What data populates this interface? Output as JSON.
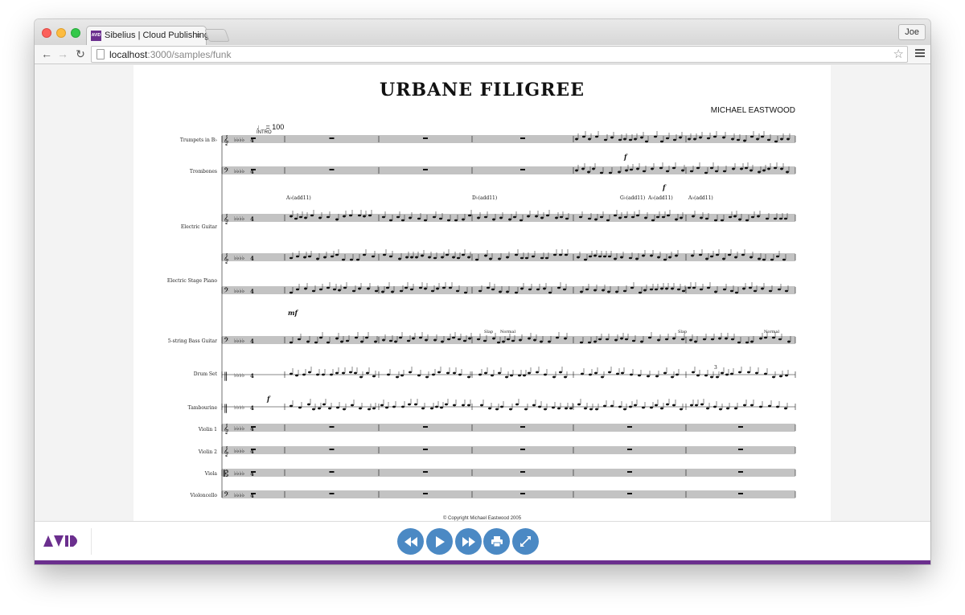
{
  "browser": {
    "tab_title": "Sibelius | Cloud Publishing",
    "tab_favicon_text": "AVID",
    "profile_name": "Joe",
    "url_host": "localhost",
    "url_rest": ":3000/samples/funk"
  },
  "score": {
    "title": "URBANE FILIGREE",
    "composer": "MICHAEL EASTWOOD",
    "tempo": "♩ = 100",
    "rehearsal_mark": "INTRO",
    "copyright": "© Copyright Michael Eastwood 2005",
    "instruments": [
      "Trumpets in B♭",
      "Trombones",
      "Electric Guitar",
      "Electric Stage Piano",
      "5-string Bass Guitar",
      "Drum Set",
      "Tambourine",
      "Violin 1",
      "Violin 2",
      "Viola",
      "Violoncello"
    ],
    "chord_symbols": [
      "A♭(add11)",
      "D♭(add11)",
      "G♭(add11)",
      "A♭(add11)",
      "A♭(add11)"
    ],
    "dynamics": [
      "f",
      "f",
      "mf",
      "f"
    ],
    "technique_text": [
      "Slap",
      "Normal",
      "Slap",
      "Normal"
    ],
    "tuplet": "3"
  },
  "player": {
    "logo_text": "AVID",
    "controls": [
      "rewind",
      "play",
      "fast-forward",
      "print",
      "fullscreen"
    ]
  },
  "colors": {
    "accent": "#4b89c4",
    "brand": "#6b2f8e"
  }
}
